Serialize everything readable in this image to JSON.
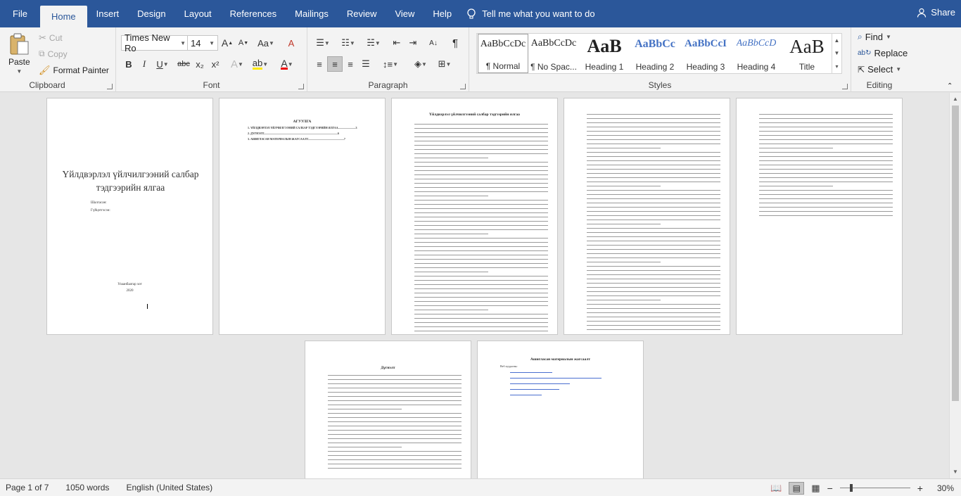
{
  "tabs": [
    "File",
    "Home",
    "Insert",
    "Design",
    "Layout",
    "References",
    "Mailings",
    "Review",
    "View",
    "Help"
  ],
  "active_tab": "Home",
  "tell_me": "Tell me what you want to do",
  "share": "Share",
  "clipboard": {
    "paste": "Paste",
    "cut": "Cut",
    "copy": "Copy",
    "format_painter": "Format Painter",
    "label": "Clipboard"
  },
  "font": {
    "name": "Times New Ro",
    "size": "14",
    "label": "Font",
    "bold": "B",
    "italic": "I",
    "underline": "U",
    "strike": "abc",
    "sub": "x₂",
    "sup": "x²",
    "grow": "A",
    "shrink": "A",
    "case": "Aa",
    "clear": "A",
    "highlight": "ab",
    "color": "A"
  },
  "paragraph": {
    "label": "Paragraph",
    "pilcrow": "¶"
  },
  "styles": {
    "label": "Styles",
    "items": [
      {
        "preview": "AaBbCcDc",
        "name": "¶ Normal"
      },
      {
        "preview": "AaBbCcDc",
        "name": "¶ No Spac..."
      },
      {
        "preview": "AaB",
        "name": "Heading 1"
      },
      {
        "preview": "AaBbCc",
        "name": "Heading 2"
      },
      {
        "preview": "AaBbCcI",
        "name": "Heading 3"
      },
      {
        "preview": "AaBbCcD",
        "name": "Heading 4"
      },
      {
        "preview": "AaB",
        "name": "Title"
      }
    ]
  },
  "editing": {
    "label": "Editing",
    "find": "Find",
    "replace": "Replace",
    "select": "Select"
  },
  "pages": {
    "p1_title": "Үйлдвэрлэл үйлчилгээний салбар тэдгээрийн ялгаа",
    "p1_line1": "Шалгасан:",
    "p1_line2": "Гүйцэтгэсэн:",
    "p1_footer1": "Улаанбаатар хот",
    "p1_footer2": "2020",
    "p2_title": "АГУУЛГА",
    "p2_item1": "1.   ҮЙЛДВЭРЛЭЛ ҮЙЛЧИЛГЭЭНИЙ САЛБАР ТЭДГЭЭРИЙН ЯЛГАА.........................3",
    "p2_item2": "2.   ДҮГНЭЛТ.........................................................................................................6",
    "p2_item3": "3.   АШИГЛАСАН МАТЕРИАЛЫН ЖАГСААЛТ...................................................7",
    "p3_title": "Үйлдвэрлэл үйлчилгээний салбар тэдгээрийн ялгаа",
    "p6_title": "Дүгнэлт",
    "p7_title": "Ашигласан материалын жагсаалт",
    "p7_sub": "Веб хуудасны:"
  },
  "status": {
    "page": "Page 1 of 7",
    "words": "1050 words",
    "language": "English (United States)",
    "zoom": "30%"
  }
}
